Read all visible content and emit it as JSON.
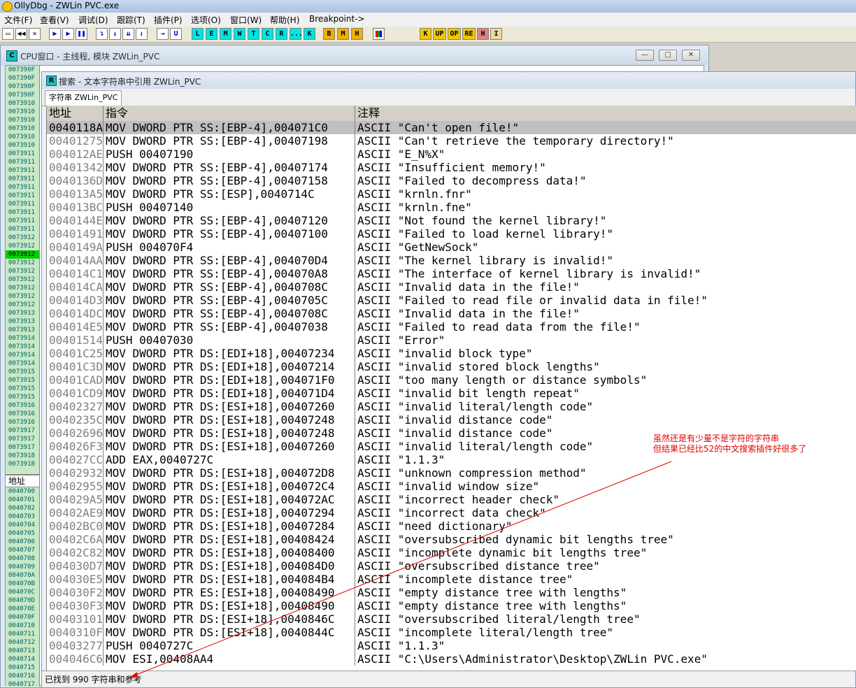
{
  "app": {
    "title": "OllyDbg - ZWLin PVC.exe"
  },
  "menu": [
    "文件(F)",
    "查看(V)",
    "调试(D)",
    "跟踪(T)",
    "插件(P)",
    "选项(O)",
    "窗口(W)",
    "帮助(H)",
    "Breakpoint->"
  ],
  "toolbar_letters": {
    "cyan": [
      "L",
      "E",
      "M",
      "W",
      "T",
      "C",
      "R",
      "...",
      "K"
    ],
    "orange": [
      "B",
      "M",
      "H"
    ],
    "right": [
      "K",
      "UP",
      "OP",
      "RE",
      "H",
      "I"
    ]
  },
  "cpu_window": {
    "icon": "C",
    "title": "CPU窗口 - 主线程, 模块 ZWLin_PVC",
    "addr_header": "地址"
  },
  "cpu_addresses": [
    "007390F",
    "007390F",
    "007390F",
    "007390F",
    "0073910",
    "0073910",
    "0073910",
    "0073910",
    "0073910",
    "0073910",
    "0073911",
    "0073911",
    "0073911",
    "0073911",
    "0073911",
    "0073911",
    "0073911",
    "0073911",
    "0073911",
    "0073911",
    "0073912",
    "0073912",
    "0073912",
    "0073912",
    "0073912",
    "0073912",
    "0073912",
    "0073912",
    "0073912",
    "0073913",
    "0073913",
    "0073913",
    "0073914",
    "0073914",
    "0073914",
    "0073914",
    "0073915",
    "0073915",
    "0073915",
    "0073915",
    "0073916",
    "0073916",
    "0073916",
    "0073917",
    "0073917",
    "0073917",
    "0073918",
    "0073918"
  ],
  "cpu_addresses_bottom": [
    "0040700",
    "0040701",
    "0040702",
    "0040703",
    "0040704",
    "0040705",
    "0040706",
    "0040707",
    "0040708",
    "0040709",
    "004070A",
    "004070B",
    "004070C",
    "004070D",
    "004070E",
    "004070F",
    "0040710",
    "0040711",
    "0040712",
    "0040713",
    "0040714",
    "0040715",
    "0040716",
    "0040717",
    "0040718",
    "0040719",
    "004071A",
    "004071B"
  ],
  "search_window": {
    "icon": "R",
    "title": "搜索 - 文本字符串中引用 ZWLin_PVC",
    "tab": "字符串 ZWLin_PVC",
    "columns": [
      "地址",
      "指令",
      "注释"
    ],
    "rows": [
      [
        "0040118A",
        "MOV DWORD PTR SS:[EBP-4],004071C0",
        "ASCII \"Can't open file!\""
      ],
      [
        "00401275",
        "MOV DWORD PTR SS:[EBP-4],00407198",
        "ASCII \"Can't retrieve the temporary directory!\""
      ],
      [
        "004012AE",
        "PUSH 00407190",
        "ASCII \"E_N%X\""
      ],
      [
        "00401342",
        "MOV DWORD PTR SS:[EBP-4],00407174",
        "ASCII \"Insufficient memory!\""
      ],
      [
        "0040136D",
        "MOV DWORD PTR SS:[EBP-4],00407158",
        "ASCII \"Failed to decompress data!\""
      ],
      [
        "004013A5",
        "MOV DWORD PTR SS:[ESP],0040714C",
        "ASCII \"krnln.fnr\""
      ],
      [
        "004013BC",
        "PUSH 00407140",
        "ASCII \"krnln.fne\""
      ],
      [
        "0040144E",
        "MOV DWORD PTR SS:[EBP-4],00407120",
        "ASCII \"Not found the kernel library!\""
      ],
      [
        "00401491",
        "MOV DWORD PTR SS:[EBP-4],00407100",
        "ASCII \"Failed to load kernel library!\""
      ],
      [
        "0040149A",
        "PUSH 004070F4",
        "ASCII \"GetNewSock\""
      ],
      [
        "004014AA",
        "MOV DWORD PTR SS:[EBP-4],004070D4",
        "ASCII \"The kernel library is invalid!\""
      ],
      [
        "004014C1",
        "MOV DWORD PTR SS:[EBP-4],004070A8",
        "ASCII \"The interface of kernel library is invalid!\""
      ],
      [
        "004014CA",
        "MOV DWORD PTR SS:[EBP-4],0040708C",
        "ASCII \"Invalid data in the file!\""
      ],
      [
        "004014D3",
        "MOV DWORD PTR SS:[EBP-4],0040705C",
        "ASCII \"Failed to read file or invalid data in file!\""
      ],
      [
        "004014DC",
        "MOV DWORD PTR SS:[EBP-4],0040708C",
        "ASCII \"Invalid data in the file!\""
      ],
      [
        "004014E5",
        "MOV DWORD PTR SS:[EBP-4],00407038",
        "ASCII \"Failed to read data from the file!\""
      ],
      [
        "00401514",
        "PUSH 00407030",
        "ASCII \"Error\""
      ],
      [
        "00401C25",
        "MOV DWORD PTR DS:[EDI+18],00407234",
        "ASCII \"invalid block type\""
      ],
      [
        "00401C3D",
        "MOV DWORD PTR DS:[EDI+18],00407214",
        "ASCII \"invalid stored block lengths\""
      ],
      [
        "00401CAD",
        "MOV DWORD PTR DS:[EDI+18],004071F0",
        "ASCII \"too many length or distance symbols\""
      ],
      [
        "00401CD9",
        "MOV DWORD PTR DS:[EDI+18],004071D4",
        "ASCII \"invalid bit length repeat\""
      ],
      [
        "00402327",
        "MOV DWORD PTR DS:[ESI+18],00407260",
        "ASCII \"invalid literal/length code\""
      ],
      [
        "0040235C",
        "MOV DWORD PTR DS:[ESI+18],00407248",
        "ASCII \"invalid distance code\""
      ],
      [
        "00402696",
        "MOV DWORD PTR DS:[ESI+18],00407248",
        "ASCII \"invalid distance code\""
      ],
      [
        "004026F3",
        "MOV DWORD PTR DS:[ESI+18],00407260",
        "ASCII \"invalid literal/length code\""
      ],
      [
        "004027CC",
        "ADD EAX,0040727C",
        "ASCII \"1.1.3\""
      ],
      [
        "00402932",
        "MOV DWORD PTR DS:[ESI+18],004072D8",
        "ASCII \"unknown compression method\""
      ],
      [
        "00402955",
        "MOV DWORD PTR DS:[ESI+18],004072C4",
        "ASCII \"invalid window size\""
      ],
      [
        "004029A5",
        "MOV DWORD PTR DS:[ESI+18],004072AC",
        "ASCII \"incorrect header check\""
      ],
      [
        "00402AE9",
        "MOV DWORD PTR DS:[ESI+18],00407294",
        "ASCII \"incorrect data check\""
      ],
      [
        "00402BC0",
        "MOV DWORD PTR DS:[ESI+18],00407284",
        "ASCII \"need dictionary\""
      ],
      [
        "00402C6A",
        "MOV DWORD PTR DS:[ESI+18],00408424",
        "ASCII \"oversubscribed dynamic bit lengths tree\""
      ],
      [
        "00402C82",
        "MOV DWORD PTR DS:[ESI+18],00408400",
        "ASCII \"incomplete dynamic bit lengths tree\""
      ],
      [
        "004030D7",
        "MOV DWORD PTR DS:[ESI+18],004084D0",
        "ASCII \"oversubscribed distance tree\""
      ],
      [
        "004030E5",
        "MOV DWORD PTR DS:[ESI+18],004084B4",
        "ASCII \"incomplete distance tree\""
      ],
      [
        "004030F2",
        "MOV DWORD PTR ES:[ESI+18],00408490",
        "ASCII \"empty distance tree with lengths\""
      ],
      [
        "004030F3",
        "MOV DWORD PTR DS:[ESI+18],00408490",
        "ASCII \"empty distance tree with lengths\""
      ],
      [
        "00403101",
        "MOV DWORD PTR DS:[ESI+18],0040846C",
        "ASCII \"oversubscribed literal/length tree\""
      ],
      [
        "0040310F",
        "MOV DWORD PTR DS:[ESI+18],0040844C",
        "ASCII \"incomplete literal/length tree\""
      ],
      [
        "00403277",
        "PUSH 0040727C",
        "ASCII \"1.1.3\""
      ],
      [
        "004046C6",
        "MOV ESI,00408AA4",
        "ASCII \"C:\\Users\\Administrator\\Desktop\\ZWLin PVC.exe\""
      ]
    ],
    "status": "已找到 990 字符串和参考"
  },
  "annotation": {
    "line1": "虽然还是有少量不是字符的字符串",
    "line2": "但结果已经比52的中文搜索插件好很多了",
    "color": "#e00000"
  }
}
